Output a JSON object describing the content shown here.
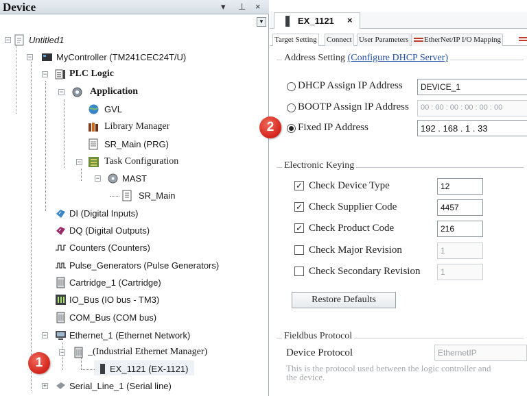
{
  "device_panel": {
    "title": "Device",
    "header_buttons": [
      "▾",
      "⊥",
      "×"
    ],
    "tree": {
      "project": "Untitled1",
      "controller": "MyController (TM241CEC24T/U)",
      "plc_logic": "PLC Logic",
      "application": "Application",
      "gvl": "GVL",
      "library_manager": "Library Manager",
      "sr_main_prg": "SR_Main (PRG)",
      "task_configuration": "Task Configuration",
      "mast": "MAST",
      "sr_main": "SR_Main",
      "di": "DI (Digital Inputs)",
      "dq": "DQ (Digital Outputs)",
      "counters": "Counters (Counters)",
      "pulse_generators": "Pulse_Generators (Pulse Generators)",
      "cartridge": "Cartridge_1 (Cartridge)",
      "io_bus": "IO_Bus (IO bus - TM3)",
      "com_bus": "COM_Bus (COM bus)",
      "ethernet": "Ethernet_1 (Ethernet Network)",
      "industrial_ethernet": "_(Industrial Ethernet Manager)",
      "ex_1121": "EX_1121 (EX-1121)",
      "serial_line": "Serial_Line_1 (Serial line)"
    }
  },
  "badges": [
    "1",
    "2"
  ],
  "editor": {
    "doc_tab": {
      "label": "EX_1121",
      "close": "×"
    },
    "subtabs": [
      "Target Setting",
      "Connect",
      "User Parameters",
      "EtherNet/IP I/O Mapping"
    ],
    "address_setting": {
      "title": "Address Setting",
      "link": "(Configure DHCP Server)",
      "dhcp_label": "DHCP Assign IP Address",
      "dhcp_value": "DEVICE_1",
      "bootp_label": "BOOTP Assign IP Address",
      "bootp_value": "00 : 00 : 00 : 00 : 00 : 00",
      "fixed_label": "Fixed IP Address",
      "fixed_value": "192  .  168  .   1   .  33",
      "selected": "fixed"
    },
    "electronic_keying": {
      "title": "Electronic Keying",
      "items": [
        {
          "label": "Check Device Type",
          "checked": true,
          "value": "12"
        },
        {
          "label": "Check Supplier Code",
          "checked": true,
          "value": "4457"
        },
        {
          "label": "Check Product Code",
          "checked": true,
          "value": "216"
        },
        {
          "label": "Check Major Revision",
          "checked": false,
          "value": "1"
        },
        {
          "label": "Check Secondary Revision",
          "checked": false,
          "value": "1"
        }
      ],
      "restore_button": "Restore Defaults"
    },
    "fieldbus_protocol": {
      "title": "Fieldbus Protocol",
      "device_protocol_label": "Device Protocol",
      "device_protocol_value": "EthernetIP",
      "description": "This is the protocol used between the logic controller and the device."
    }
  },
  "colors": {
    "badge": "#d3231a",
    "link": "#1f4ea3",
    "tab_strip": "#f6f7f8"
  }
}
